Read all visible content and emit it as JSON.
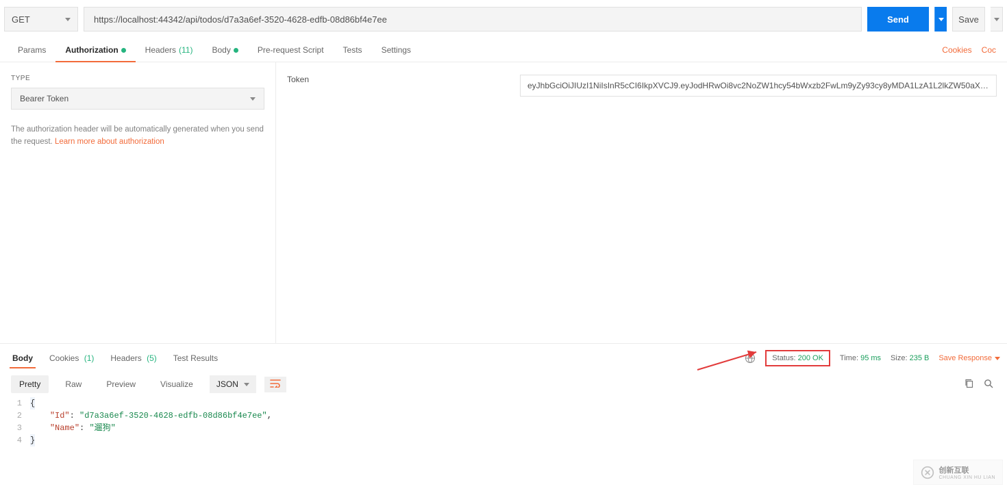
{
  "request": {
    "method": "GET",
    "url": "https://localhost:44342/api/todos/d7a3a6ef-3520-4628-edfb-08d86bf4e7ee",
    "send_label": "Send",
    "save_label": "Save"
  },
  "req_tabs": {
    "params": "Params",
    "authorization": "Authorization",
    "headers": "Headers",
    "headers_count": "(11)",
    "body": "Body",
    "prerequest": "Pre-request Script",
    "tests": "Tests",
    "settings": "Settings",
    "cookies_link": "Cookies",
    "code_link": "Coc"
  },
  "auth": {
    "type_label": "TYPE",
    "type_value": "Bearer Token",
    "note_pre": "The authorization header will be automatically generated when you send the request. ",
    "note_link": "Learn more about authorization",
    "token_label": "Token",
    "token_value": "eyJhbGciOiJIUzI1NiIsInR5cCI6IkpXVCJ9.eyJodHRwOi8vc2NoZW1hcy54bWxzb2FwLm9yZy93cy8yMDA1LzA1L2lkZW50aXR5L ..."
  },
  "resp_tabs": {
    "body": "Body",
    "cookies": "Cookies",
    "cookies_count": "(1)",
    "headers": "Headers",
    "headers_count": "(5)",
    "tests": "Test Results"
  },
  "resp_meta": {
    "status_label": "Status:",
    "status_value": "200 OK",
    "time_label": "Time:",
    "time_value": "95 ms",
    "size_label": "Size:",
    "size_value": "235 B",
    "save_response": "Save Response"
  },
  "resp_ctrl": {
    "pretty": "Pretty",
    "raw": "Raw",
    "preview": "Preview",
    "visualize": "Visualize",
    "format": "JSON"
  },
  "code": {
    "l1": "{",
    "l2_key": "\"Id\"",
    "l2_val": "\"d7a3a6ef-3520-4628-edfb-08d86bf4e7ee\"",
    "l3_key": "\"Name\"",
    "l3_val": "\"遛狗\"",
    "l4": "}"
  },
  "watermark": {
    "text_cn": "创新互联",
    "text_en": "CHUANG XIN HU LIAN"
  }
}
